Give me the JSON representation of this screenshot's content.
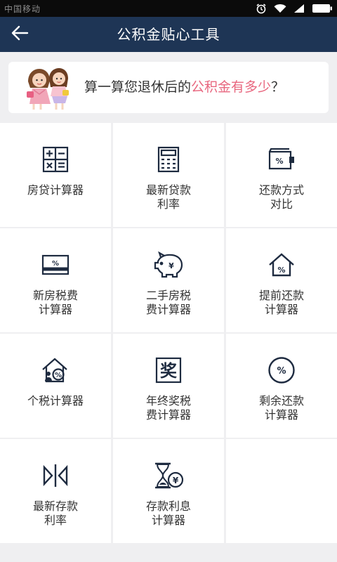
{
  "status_bar": {
    "carrier": "中国移动",
    "icons": [
      "alarm-icon",
      "wifi-icon",
      "signal-icon",
      "battery-icon"
    ]
  },
  "header": {
    "title": "公积金贴心工具",
    "back_icon": "back-arrow-icon"
  },
  "banner": {
    "text_before": "算一算您退休后的",
    "text_highlight": "公积金有多少",
    "text_after": "？",
    "highlight_color": "#e8677f"
  },
  "tools": [
    {
      "label": "房贷计算器",
      "icon": "calculator-icon"
    },
    {
      "label": "最新贷款\n利率",
      "icon": "keypad-calculator-icon"
    },
    {
      "label": "还款方式\n对比",
      "icon": "percent-wallet-icon"
    },
    {
      "label": "新房税费\n计算器",
      "icon": "percent-card-icon"
    },
    {
      "label": "二手房税\n费计算器",
      "icon": "piggy-bank-icon"
    },
    {
      "label": "提前还款\n计算器",
      "icon": "percent-house-icon"
    },
    {
      "label": "个税计算器",
      "icon": "person-house-percent-icon"
    },
    {
      "label": "年终奖税\n费计算器",
      "icon": "bonus-character-icon"
    },
    {
      "label": "剩余还款\n计算器",
      "icon": "percent-circle-icon"
    },
    {
      "label": "最新存款\n利率",
      "icon": "split-arrows-icon"
    },
    {
      "label": "存款利息\n计算器",
      "icon": "hourglass-yen-icon"
    }
  ],
  "theme": {
    "header_bg": "#1e3555",
    "page_bg": "#efeff1",
    "icon_color": "#1e2b40"
  }
}
